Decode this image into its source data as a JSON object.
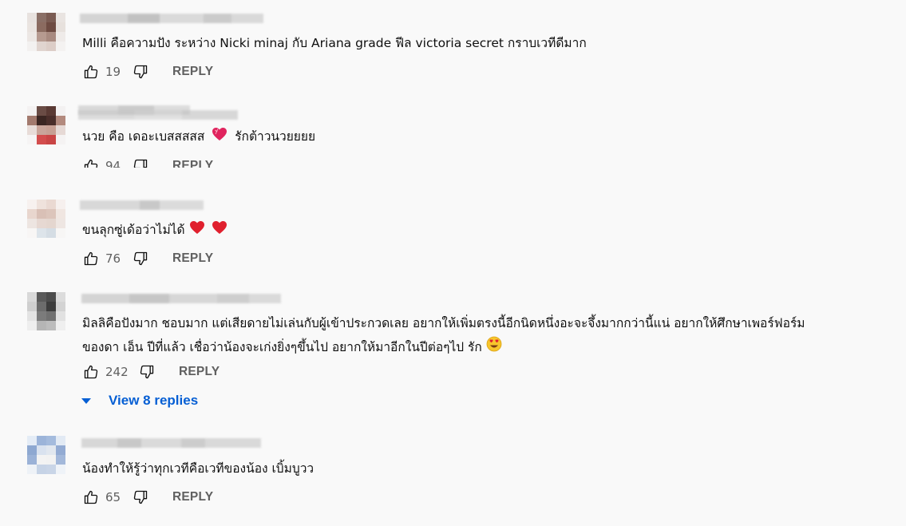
{
  "comments": [
    {
      "text": "Milli คือความปัง ระหว่าง Nicki minaj กับ Ariana grade ฟีล victoria secret กราบเวทีดีมาก",
      "likes": "19",
      "reply_label": "REPLY",
      "avatar_colors": [
        "#e8e2df",
        "#8a6f66",
        "#7a5b52",
        "#e9e4e1",
        "#eae4e0",
        "#8b6b60",
        "#6e4b42",
        "#e7e1dd",
        "#ece7e4",
        "#b69a90",
        "#a88a80",
        "#efebe9",
        "#f3f1f0",
        "#e0d4cf",
        "#dccdc7",
        "#f4f2f1"
      ]
    },
    {
      "text": "นวย คือ เดอะเบสสสสส",
      "text_after": "รักต้าวนวยยยย",
      "likes": "94",
      "reply_label": "REPLY",
      "emoji": "heart-sparkle",
      "avatar_colors": [
        "#f4f2f2",
        "#6a4c45",
        "#5a3a34",
        "#f3f1f1",
        "#a37a6e",
        "#3b2622",
        "#4a2e2a",
        "#b38a7e",
        "#e8dcd8",
        "#c9a59a",
        "#c7a094",
        "#e6d9d5",
        "#f6f4f4",
        "#d34d4d",
        "#c94545",
        "#f5f3f3"
      ]
    },
    {
      "text": "ขนลุกซู่เด้อว่าไม่ได้",
      "likes": "76",
      "reply_label": "REPLY",
      "emoji": "red-hearts",
      "avatar_colors": [
        "#f7f1ef",
        "#efe2dc",
        "#ead9d2",
        "#f6f0ee",
        "#e8d6ce",
        "#d9c0b6",
        "#dcc5bb",
        "#f0e6e1",
        "#ede5e1",
        "#e6d8d2",
        "#e4d6cf",
        "#eee6e2",
        "#f8f6f5",
        "#dde4ea",
        "#d5dde4",
        "#f7f6f5"
      ]
    },
    {
      "text": "มิลลิคือปังมาก ชอบมาก แต่เสียดายไม่เล่นกับผู้เข้าประกวดเลย อยากให้เพิ่มตรงนี้อีกนิดหนึ่งอะจะจึ้งมากกว่านี้แน่ อยากให้ศึกษาเพอร์ฟอร์ม",
      "text_line2": "ของดา เอ็น ปีที่แล้ว เชื่อว่าน้องจะเก่งยิ่งๆขึ้นไป อยากให้มาอีกในปีต่อๆไป รัก",
      "likes": "242",
      "reply_label": "REPLY",
      "emoji": "heart-eyes",
      "avatar_colors": [
        "#d9d9d9",
        "#5a5a5a",
        "#4c4c4c",
        "#dcdcdc",
        "#cfcfcf",
        "#6c6c6c",
        "#3d3d3d",
        "#d3d3d3",
        "#e3e3e3",
        "#7b7b7b",
        "#707070",
        "#e1e1e1",
        "#eeeeee",
        "#b5b5b5",
        "#bcbcbc",
        "#efefef"
      ]
    },
    {
      "text": "น้องทำให้รู้ว่าทุกเวทีคือเวทีของน้อง เบิ้มบูวว",
      "likes": "65",
      "reply_label": "REPLY",
      "avatar_colors": [
        "#e4ecf6",
        "#9cb4d9",
        "#a4bbdd",
        "#e2eaf4",
        "#8ea8d1",
        "#d9e2ef",
        "#e1e7ef",
        "#93abd3",
        "#9bb2d7",
        "#f3f3f3",
        "#f2f2f2",
        "#a3b8da",
        "#eef2f7",
        "#c6d3e6",
        "#c9d5e7",
        "#eff3f8"
      ]
    }
  ],
  "view_replies": "View 8 replies",
  "colors": {
    "link": "#065fd4",
    "muted": "#606060",
    "background": "#f9f9f9"
  }
}
